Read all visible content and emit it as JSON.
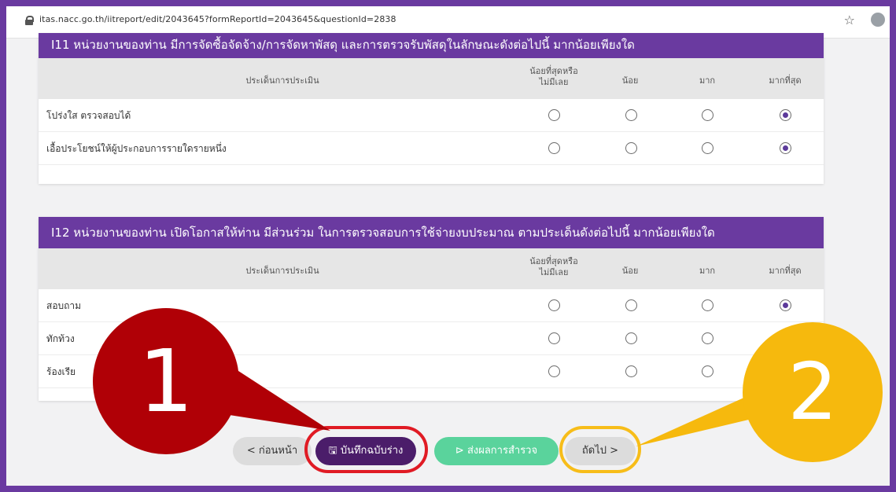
{
  "browser": {
    "url": "itas.nacc.go.th/iitreport/edit/2043645?formReportId=2043645&questionId=2838",
    "star_glyph": "☆"
  },
  "header_columns": [
    "ประเด็นการประเมิน",
    "น้อยที่สุดหรือ\nไม่มีเลย",
    "น้อย",
    "มาก",
    "มากที่สุด"
  ],
  "questions": [
    {
      "title": "I11 หน่วยงานของท่าน มีการจัดซื้อจัดจ้าง/การจัดหาพัสดุ และการตรวจรับพัสดุในลักษณะดังต่อไปนี้ มากน้อยเพียงใด",
      "rows": [
        {
          "label": "โปร่งใส ตรวจสอบได้",
          "selected": 4
        },
        {
          "label": "เอื้อประโยชน์ให้ผู้ประกอบการรายใดรายหนึ่ง",
          "selected": 4
        }
      ]
    },
    {
      "title": "I12 หน่วยงานของท่าน เปิดโอกาสให้ท่าน มีส่วนร่วม ในการตรวจสอบการใช้จ่ายงบประมาณ ตามประเด็นดังต่อไปนี้ มากน้อยเพียงใด",
      "rows": [
        {
          "label": "สอบถาม",
          "selected": 4
        },
        {
          "label": "ทักท้วง",
          "selected": 0
        },
        {
          "label": "ร้องเรีย",
          "selected": 0
        }
      ]
    }
  ],
  "buttons": {
    "prev": "< ก่อนหน้า",
    "save_draft": "บันทึกฉบับร่าง",
    "submit": "ส่งผลการสำรวจ",
    "next": "ถัดไป >"
  },
  "annotations": {
    "badge1": "1",
    "badge2": "2"
  },
  "colors": {
    "purple": "#6a3aa0",
    "dark_purple": "#4b1d6a",
    "green": "#5ad39c",
    "red": "#b00006",
    "yellow": "#f6b90d"
  }
}
